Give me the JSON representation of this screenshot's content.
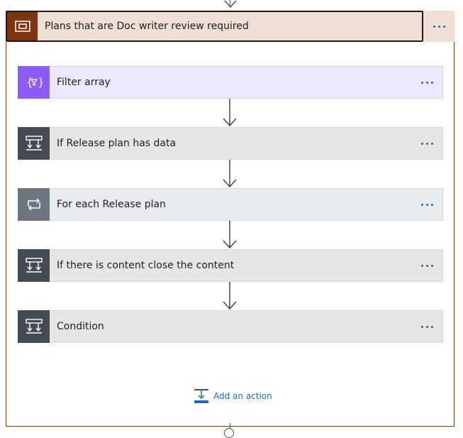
{
  "scope": {
    "title": "Plans that are Doc writer review required",
    "icon": "scope-icon",
    "color": "#7d3511",
    "header_bg": "#efdfd5"
  },
  "actions": [
    {
      "label": "Filter array",
      "icon": "filter-array-icon",
      "icon_bg": "#8b5cf6",
      "card_bg": "#ede7fd"
    },
    {
      "label": "If Release plan has data",
      "icon": "condition-icon",
      "icon_bg": "#454b52",
      "card_bg": "#e6e6e6"
    },
    {
      "label": "For each Release plan",
      "icon": "loop-icon",
      "icon_bg": "#6b7680",
      "card_bg": "#e8ebee"
    },
    {
      "label": "If there is content close the content",
      "icon": "condition-icon",
      "icon_bg": "#454b52",
      "card_bg": "#e6e6e6"
    },
    {
      "label": "Condition",
      "icon": "condition-icon",
      "icon_bg": "#454b52",
      "card_bg": "#e6e6e6"
    }
  ],
  "add_action": {
    "label": "Add an action",
    "icon": "add-action-icon",
    "color": "#1a6fb4"
  },
  "more_icon": "more-options-icon",
  "accent": "#0f6cbd"
}
